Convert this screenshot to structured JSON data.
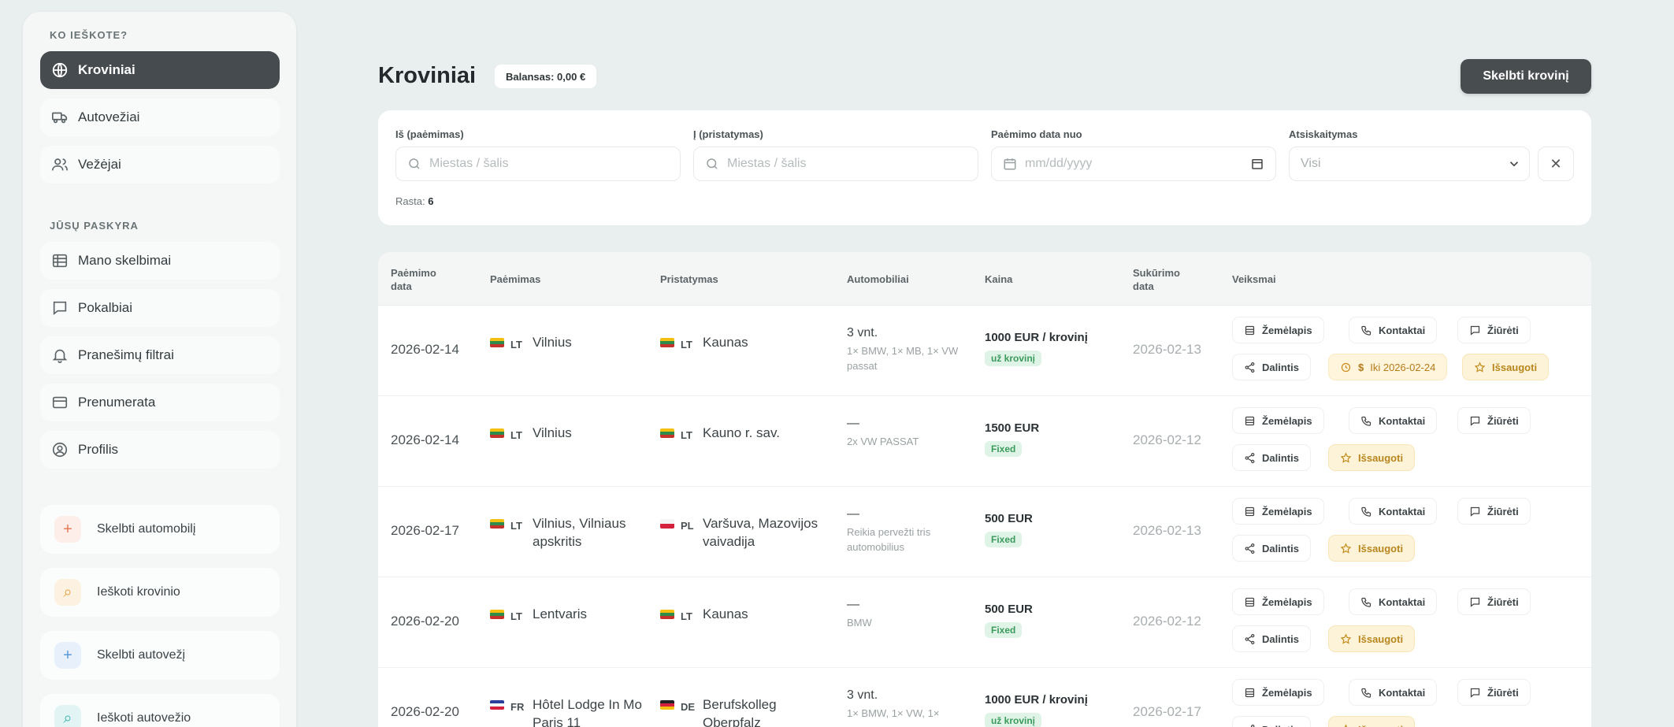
{
  "sidebar": {
    "section_main": "KO IEŠKOTE?",
    "nav": [
      {
        "label": "Kroviniai",
        "icon": "globe-icon"
      },
      {
        "label": "Autovežiai",
        "icon": "truck-icon"
      },
      {
        "label": "Vežėjai",
        "icon": "users-icon"
      }
    ],
    "section_account": "JŪSŲ PASKYRA",
    "account": [
      {
        "label": "Mano skelbimai",
        "icon": "grid-icon"
      },
      {
        "label": "Pokalbiai",
        "icon": "chat-icon"
      },
      {
        "label": "Pranešimų filtrai",
        "icon": "bell-icon"
      },
      {
        "label": "Prenumerata",
        "icon": "card-icon"
      },
      {
        "label": "Profilis",
        "icon": "profile-icon"
      }
    ],
    "actions": [
      {
        "label": "Skelbti automobilį",
        "icon": "plus-icon",
        "glyph": "+",
        "color": "#e8795a",
        "bg": "#fdeee9"
      },
      {
        "label": "Ieškoti krovinio",
        "icon": "search-icon",
        "glyph": "⌕",
        "color": "#e3a344",
        "bg": "#fdf2e2"
      },
      {
        "label": "Skelbti autovežį",
        "icon": "plus-icon",
        "glyph": "+",
        "color": "#5b9ad6",
        "bg": "#e8f1fb"
      },
      {
        "label": "Ieškoti autovežio",
        "icon": "search-icon",
        "glyph": "⌕",
        "color": "#3fb6b0",
        "bg": "#e2f5f4"
      }
    ]
  },
  "header": {
    "title": "Kroviniai",
    "balance": "Balansas: 0,00 €",
    "post_button": "Skelbti krovinį"
  },
  "filters": {
    "from_label": "Iš (paėmimas)",
    "from_placeholder": "Miestas / šalis",
    "to_label": "Į (pristatymas)",
    "to_placeholder": "Miestas / šalis",
    "date_label": "Paėmimo data nuo",
    "date_placeholder": "mm/dd/yyyy",
    "payment_label": "Atsiskaitymas",
    "payment_value": "Visi",
    "found_label": "Rasta:",
    "found_count": "6"
  },
  "table": {
    "headers": {
      "pickup_date": "Paėmimo data",
      "pickup": "Paėmimas",
      "delivery": "Pristatymas",
      "vehicles": "Automobiliai",
      "price": "Kaina",
      "published": "Sukūrimo data",
      "actions": "Veiksmai"
    },
    "buttons": {
      "map": "Žemėlapis",
      "contacts": "Kontaktai",
      "view": "Žiūrėti",
      "share": "Dalintis",
      "save": "Išsaugoti"
    },
    "rows": [
      {
        "pickup_date": "2026-02-14",
        "from_cc": "LT",
        "from_flag": "lt",
        "from": "Vilnius",
        "to_cc": "LT",
        "to_flag": "lt",
        "to": "Kaunas",
        "veh_main": "3 vnt.",
        "veh_sub": "1× BMW, 1× MB, 1× VW passat",
        "price": "1000 EUR / krovinį",
        "price_tag": "už krovinį",
        "published": "2026-02-13",
        "deadline": "Iki 2026-02-24",
        "deadline_icon": "$"
      },
      {
        "pickup_date": "2026-02-14",
        "from_cc": "LT",
        "from_flag": "lt",
        "from": "Vilnius",
        "to_cc": "LT",
        "to_flag": "lt",
        "to": "Kauno r. sav.",
        "veh_main": "—",
        "veh_sub": "2x VW PASSAT",
        "price": "1500 EUR",
        "price_tag": "Fixed",
        "published": "2026-02-12"
      },
      {
        "pickup_date": "2026-02-17",
        "from_cc": "LT",
        "from_flag": "lt",
        "from": "Vilnius, Vilniaus apskritis",
        "to_cc": "PL",
        "to_flag": "pl",
        "to": "Varšuva, Mazovijos vaivadija",
        "veh_main": "—",
        "veh_sub": "Reikia pervežti tris automobilius",
        "price": "500 EUR",
        "price_tag": "Fixed",
        "published": "2026-02-13"
      },
      {
        "pickup_date": "2026-02-20",
        "from_cc": "LT",
        "from_flag": "lt",
        "from": "Lentvaris",
        "to_cc": "LT",
        "to_flag": "lt",
        "to": "Kaunas",
        "veh_main": "—",
        "veh_sub": "BMW",
        "price": "500 EUR",
        "price_tag": "Fixed",
        "published": "2026-02-12"
      },
      {
        "pickup_date": "2026-02-20",
        "from_cc": "FR",
        "from_flag": "fr",
        "from": "Hôtel Lodge In Mo Paris 11",
        "to_cc": "DE",
        "to_flag": "de",
        "to": "Berufskolleg Oberpfalz",
        "veh_main": "3 vnt.",
        "veh_sub": "1× BMW, 1× VW, 1×",
        "price": "1000 EUR / krovinį",
        "price_tag": "už krovinį",
        "published": "2026-02-17"
      }
    ]
  },
  "colors": {
    "accent_dark": "#454b4e",
    "price_tag_bg": "#dff4e6",
    "price_tag_text": "#3b9a5c",
    "save_bg": "#fdf3d9"
  }
}
